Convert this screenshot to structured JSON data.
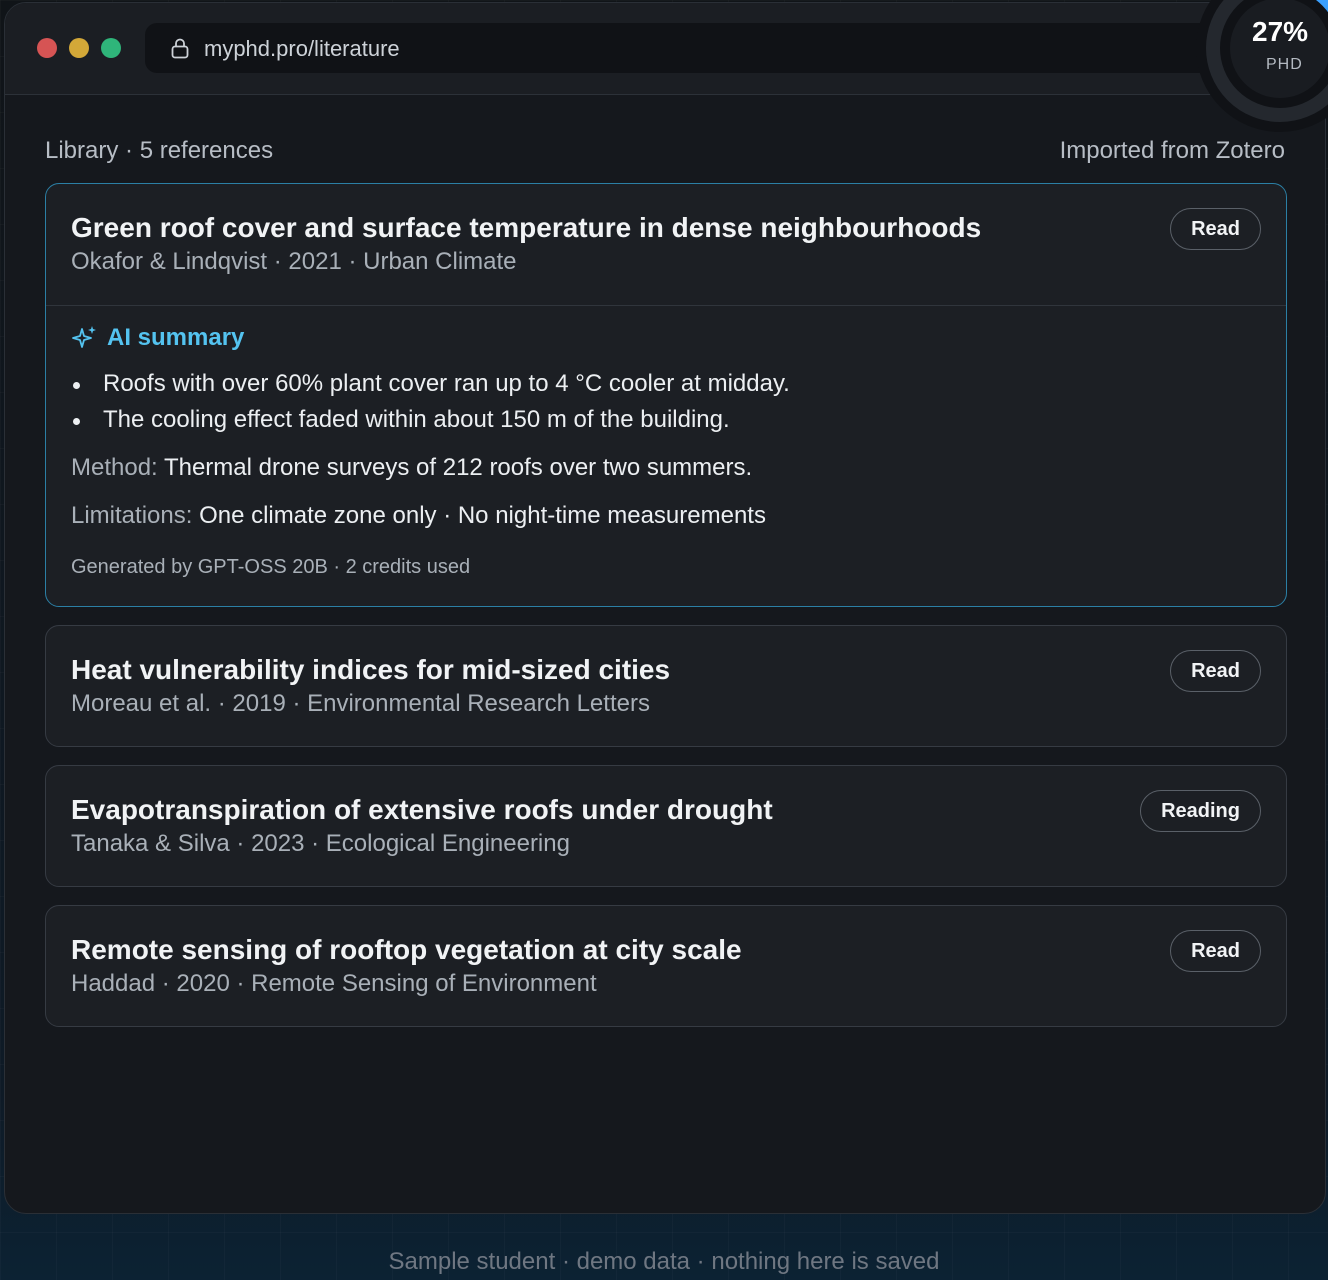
{
  "browser": {
    "url": "myphd.pro/literature",
    "controls": {
      "close": "#d65454",
      "minimize": "#d3a838",
      "maximize": "#2fb57a"
    }
  },
  "progress": {
    "percent_text": "27%",
    "value": 0.27,
    "label": "PHD",
    "accent": "#3aa0ff"
  },
  "library": {
    "title": "Library · 5 references",
    "source": "Imported from Zotero"
  },
  "papers": [
    {
      "title": "Green roof cover and surface temperature in dense neighbourhoods",
      "meta": "Okafor & Lindqvist · 2021 · Urban Climate",
      "status": "Read",
      "summary": {
        "label": "AI summary",
        "icon": "sparkle-icon",
        "bullets": [
          "Roofs with over 60% plant cover ran up to 4 °C cooler at midday.",
          "The cooling effect faded within about 150 m of the building."
        ],
        "method_label": "Method:",
        "method": "Thermal drone surveys of 212 roofs over two summers.",
        "limitations_label": "Limitations:",
        "limitations": "One climate zone only · No night-time measurements",
        "generated": "Generated by GPT-OSS 20B · 2 credits used"
      }
    },
    {
      "title": "Heat vulnerability indices for mid-sized cities",
      "meta": "Moreau et al. · 2019 · Environmental Research Letters",
      "status": "Read"
    },
    {
      "title": "Evapotranspiration of extensive roofs under drought",
      "meta": "Tanaka & Silva · 2023 · Ecological Engineering",
      "status": "Reading"
    },
    {
      "title": "Remote sensing of rooftop vegetation at city scale",
      "meta": "Haddad · 2020 · Remote Sensing of Environment",
      "status": "Read"
    }
  ],
  "footer": "Sample student · demo data · nothing here is saved",
  "colors": {
    "accent_blue": "#54c3f0",
    "card_border_active": "#2b7fa5"
  }
}
